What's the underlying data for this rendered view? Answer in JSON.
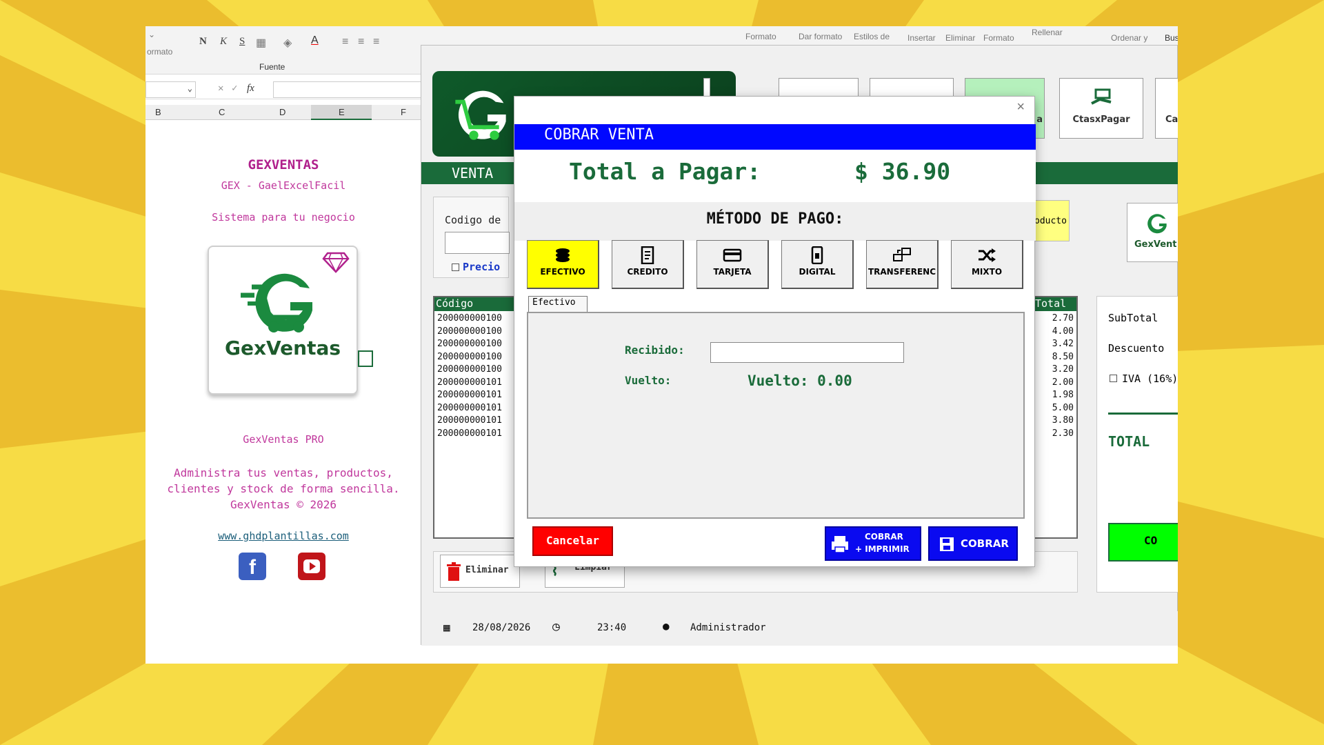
{
  "colors": {
    "background": "#f5d52e",
    "dark_green": "#1a6b3a",
    "blue": "#0008ff",
    "red": "#ff0000",
    "yellow": "#ffff00",
    "bright_green": "#00ff00"
  },
  "ribbon": {
    "formato_left": "ormato",
    "bold": "N",
    "italic": "K",
    "underline": "S",
    "font_group": "Fuente",
    "formato": "Formato",
    "dar_formato": "Dar formato",
    "estilos_de": "Estilos de",
    "insertar": "Insertar",
    "eliminar": "Eliminar",
    "formato2": "Formato",
    "rellenar": "Rellenar",
    "ordenar": "Ordenar y",
    "buscar": "Bus"
  },
  "formula_bar": {
    "fx": "fx"
  },
  "columns": [
    "B",
    "C",
    "D",
    "E",
    "F"
  ],
  "left_panel": {
    "title": "GEXVENTAS",
    "subtitle": "GEX - GaelExcelFacil",
    "tagline": "Sistema para tu negocio",
    "logo_text": "GexVentas",
    "pro": "GexVentas PRO",
    "desc1": "Administra tus ventas, productos,",
    "desc2": "clientes y stock de forma sencilla.",
    "copyright": "GexVentas © 2026",
    "website": "www.ghdplantillas.com"
  },
  "app": {
    "section": "VENTA",
    "code_label": "Codigo de",
    "precio_label": "Precio",
    "producto_btn": "oducto",
    "tool_partial": "a",
    "ctas_pagar": "CtasxPagar",
    "cat_partial": "Cat",
    "brand_logo": "GexVent",
    "grid_codigo": "Código",
    "grid_total": "Total",
    "codes": [
      "200000000100",
      "200000000100",
      "200000000100",
      "200000000100",
      "200000000100",
      "200000000101",
      "200000000101",
      "200000000101",
      "200000000101",
      "200000000101"
    ],
    "totals": [
      "2.70",
      "4.00",
      "3.42",
      "8.50",
      "3.20",
      "2.00",
      "1.98",
      "5.00",
      "3.80",
      "2.30"
    ],
    "subtotal": "SubTotal",
    "descuento": "Descuento",
    "iva": "IVA (16%)",
    "total": "TOTAL",
    "cobrar_partial": "CO",
    "eliminar": "Eliminar",
    "limpiar": "Limpiar",
    "date": "28/08/2026",
    "time": "23:40",
    "user": "Administrador"
  },
  "modal": {
    "title": "COBRAR VENTA",
    "total_label": "Total a Pagar:",
    "total_value": "$ 36.90",
    "metodo": "MÉTODO DE PAGO:",
    "methods": [
      "EFECTIVO",
      "CREDITO",
      "TARJETA",
      "DIGITAL",
      "TRANSFERENC",
      "MIXTO"
    ],
    "tab": "Efectivo",
    "recibido": "Recibido:",
    "recibido_value": "",
    "vuelto_label": "Vuelto:",
    "vuelto_display": "Vuelto: 0.00",
    "cancelar": "Cancelar",
    "cobrar_imprimir_1": "COBRAR",
    "cobrar_imprimir_2": "+ IMPRIMIR",
    "cobrar": "COBRAR"
  }
}
